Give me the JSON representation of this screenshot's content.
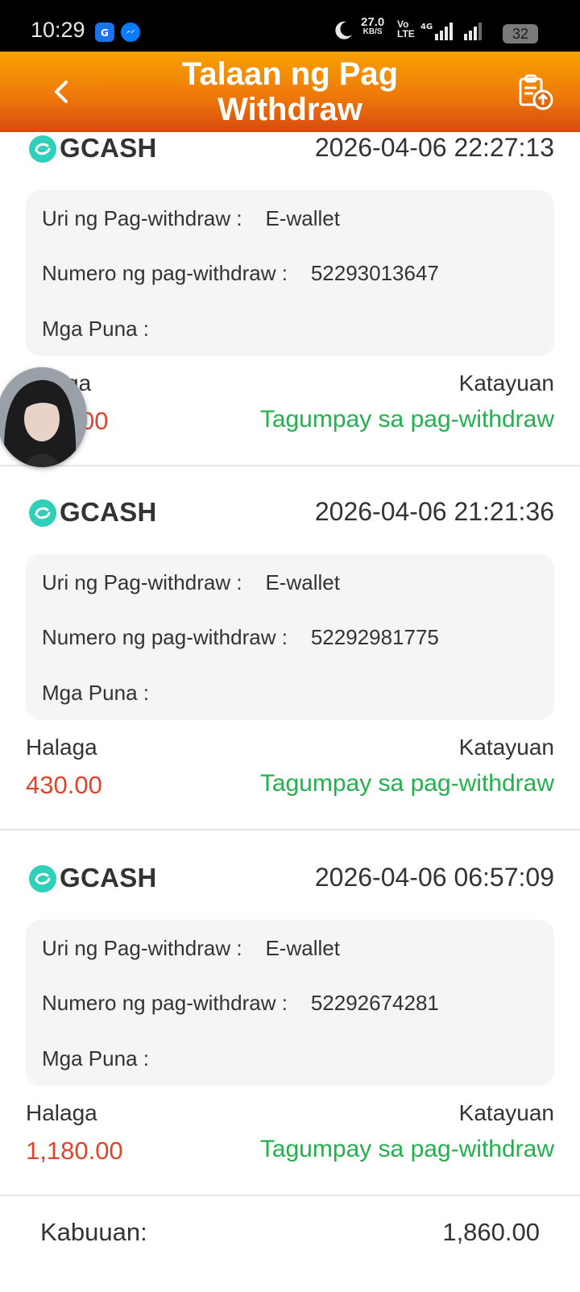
{
  "status_bar": {
    "time": "10:29",
    "net_speed": "27.0",
    "net_unit": "KB/S",
    "volte": "Vo",
    "volte2": "LTE",
    "network": "4G",
    "battery": "32"
  },
  "header": {
    "title": "Talaan ng Pag Withdraw",
    "back_icon": "chevron-left-icon",
    "action_icon": "clipboard-upload-icon",
    "gradient_top": "#f7a200",
    "gradient_bottom": "#d84a0f"
  },
  "labels": {
    "type": "Uri ng Pag-withdraw :",
    "number": "Numero ng pag-withdraw :",
    "remarks": "Mga Puna :",
    "amount": "Halaga",
    "status": "Katayuan"
  },
  "colors": {
    "amount": "#e0442c",
    "status_success": "#22b14c",
    "gcash": "#2fd0b9"
  },
  "records": [
    {
      "provider": "GCASH",
      "date": "2026-04-06 22:27:13",
      "type": "E-wallet",
      "number": "52293013647",
      "remarks": "",
      "amount_label_visible": "ga",
      "amount_visible": "00",
      "status": "Tagumpay sa pag-withdraw"
    },
    {
      "provider": "GCASH",
      "date": "2026-04-06 21:21:36",
      "type": "E-wallet",
      "number": "52292981775",
      "remarks": "",
      "amount": "430.00",
      "status": "Tagumpay sa pag-withdraw"
    },
    {
      "provider": "GCASH",
      "date": "2026-04-06 06:57:09",
      "type": "E-wallet",
      "number": "52292674281",
      "remarks": "",
      "amount": "1,180.00",
      "status": "Tagumpay sa pag-withdraw"
    }
  ],
  "footer": {
    "total_label": "Kabuuan:",
    "total_value": "1,860.00"
  }
}
